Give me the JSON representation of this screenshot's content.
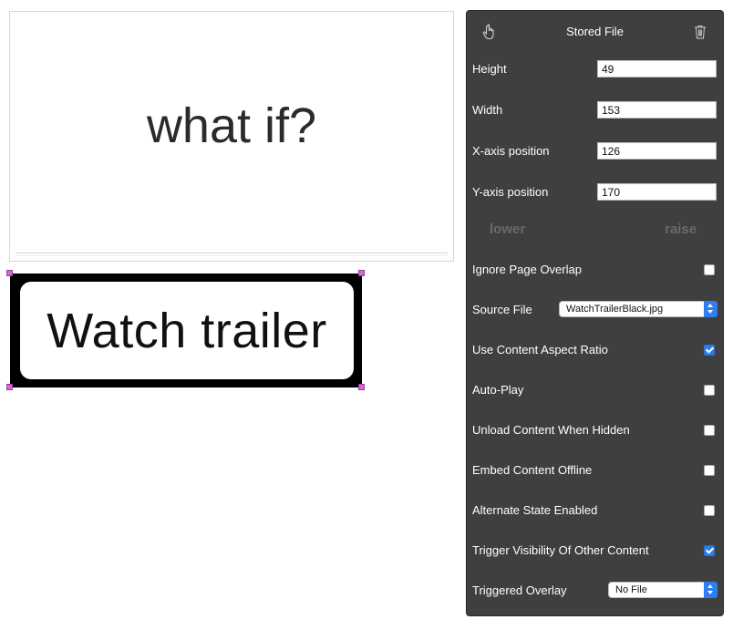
{
  "canvas": {
    "headline": "what if?",
    "trailer_text": "Watch trailer"
  },
  "panel": {
    "title": "Stored File",
    "icons": {
      "left": "hand-pointer-icon",
      "right": "trash-icon"
    },
    "height_label": "Height",
    "height_value": "49",
    "width_label": "Width",
    "width_value": "153",
    "x_label": "X-axis position",
    "x_value": "126",
    "y_label": "Y-axis position",
    "y_value": "170",
    "lower_label": "lower",
    "raise_label": "raise",
    "ignore_overlap_label": "Ignore Page Overlap",
    "ignore_overlap_checked": false,
    "source_file_label": "Source File",
    "source_file_value": "WatchTrailerBlack.jpg",
    "aspect_label": "Use Content Aspect Ratio",
    "aspect_checked": true,
    "autoplay_label": "Auto-Play",
    "autoplay_checked": false,
    "unload_label": "Unload Content When Hidden",
    "unload_checked": false,
    "embed_label": "Embed Content Offline",
    "embed_checked": false,
    "alternate_label": "Alternate State Enabled",
    "alternate_checked": false,
    "trigger_label": "Trigger Visibility Of Other Content",
    "trigger_checked": true,
    "triggered_overlay_label": "Triggered Overlay",
    "triggered_overlay_value": "No File"
  },
  "colors": {
    "panel_bg": "#3f3f3f",
    "accent": "#2c7ef2",
    "selection_handle": "#d36ad3"
  }
}
